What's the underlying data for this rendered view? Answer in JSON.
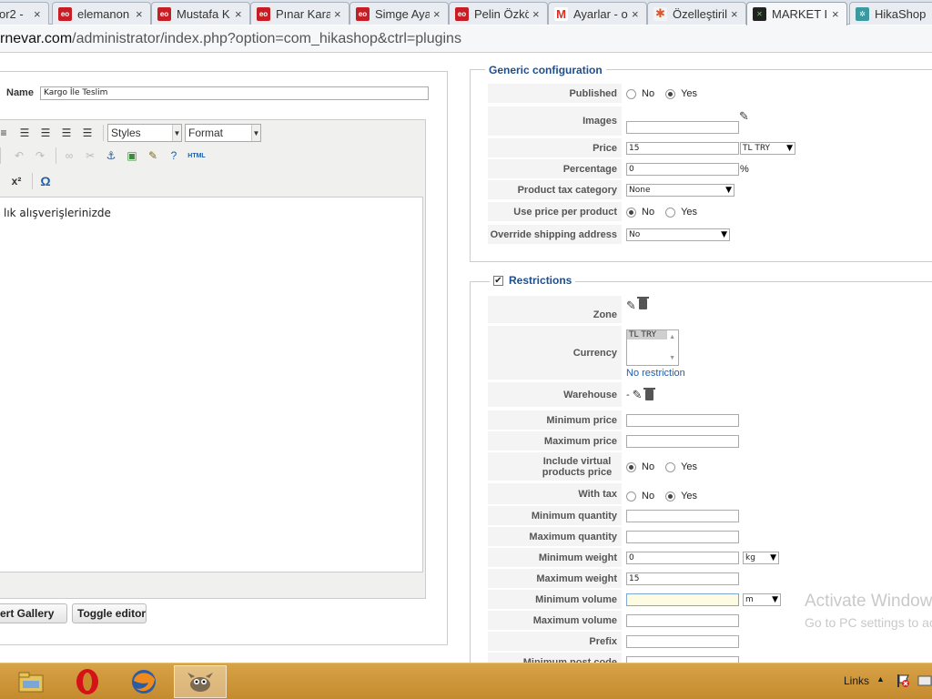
{
  "browser": {
    "tabs": [
      {
        "label": "or2 -",
        "icon": "generic-page-icon",
        "active": false
      },
      {
        "label": "elemanon",
        "icon": "eo-icon",
        "active": false
      },
      {
        "label": "Mustafa K",
        "icon": "eo-icon",
        "active": false
      },
      {
        "label": "Pınar Kara",
        "icon": "eo-icon",
        "active": false
      },
      {
        "label": "Simge Aya",
        "icon": "eo-icon",
        "active": false
      },
      {
        "label": "Pelin Özkö",
        "icon": "eo-icon",
        "active": false
      },
      {
        "label": "Ayarlar - o",
        "icon": "gmail-icon",
        "active": false
      },
      {
        "label": "Özelleştiril",
        "icon": "joomla-icon",
        "active": false
      },
      {
        "label": "MARKET II",
        "icon": "market-icon",
        "active": true
      },
      {
        "label": "HikaShop",
        "icon": "hikashop-icon",
        "active": false
      }
    ],
    "tab_close_glyph": "×",
    "url_host": "rnevar.com",
    "url_path": "/administrator/index.php?option=com_hikashop&ctrl=plugins"
  },
  "editor": {
    "name_label": "Name",
    "name_value": "Kargo İle Teslim",
    "styles_select": "Styles",
    "format_select": "Format",
    "superscript": "x²",
    "omega": "Ω",
    "html_label": "HTML",
    "body_text": "lık alışverişlerinizde",
    "insert_gallery_button": "ert Gallery",
    "toggle_editor_button": "Toggle editor"
  },
  "generic_config": {
    "legend": "Generic configuration",
    "published": {
      "label": "Published",
      "options": [
        "No",
        "Yes"
      ],
      "selected": "Yes"
    },
    "images": {
      "label": "Images",
      "value": ""
    },
    "price": {
      "label": "Price",
      "value": "15",
      "currency": "TL TRY"
    },
    "percentage": {
      "label": "Percentage",
      "value": "0",
      "unit": "%"
    },
    "product_tax_category": {
      "label": "Product tax category",
      "value": "None"
    },
    "use_price_per_product": {
      "label": "Use price per product",
      "options": [
        "No",
        "Yes"
      ],
      "selected": "No"
    },
    "override_shipping_address": {
      "label": "Override shipping address",
      "value": "No"
    }
  },
  "restrictions": {
    "legend": "Restrictions",
    "enabled": true,
    "zone": {
      "label": "Zone"
    },
    "currency": {
      "label": "Currency",
      "list_item": "TL TRY",
      "note": "No restriction"
    },
    "warehouse": {
      "label": "Warehouse",
      "value": "-"
    },
    "minimum_price": {
      "label": "Minimum price",
      "value": ""
    },
    "maximum_price": {
      "label": "Maximum price",
      "value": ""
    },
    "include_virtual": {
      "label": "Include virtual products price",
      "options": [
        "No",
        "Yes"
      ],
      "selected": "No"
    },
    "with_tax": {
      "label": "With tax",
      "options": [
        "No",
        "Yes"
      ],
      "selected": "Yes"
    },
    "minimum_quantity": {
      "label": "Minimum quantity",
      "value": ""
    },
    "maximum_quantity": {
      "label": "Maximum quantity",
      "value": ""
    },
    "minimum_weight": {
      "label": "Minimum weight",
      "value": "0",
      "unit": "kg"
    },
    "maximum_weight": {
      "label": "Maximum weight",
      "value": "15"
    },
    "minimum_volume": {
      "label": "Minimum volume",
      "value": "",
      "unit": "m"
    },
    "maximum_volume": {
      "label": "Maximum volume",
      "value": ""
    },
    "prefix": {
      "label": "Prefix",
      "value": ""
    },
    "minimum_post_code": {
      "label": "Minimum post code",
      "value": ""
    }
  },
  "watermark": {
    "line1": "Activate Windows",
    "line2": "Go to PC settings to activate"
  },
  "taskbar": {
    "apps": [
      "file-explorer-icon",
      "opera-icon",
      "firefox-icon",
      "gimp-icon"
    ],
    "active_app": "gimp-icon",
    "tray_links": "Links",
    "tray_arrow": "▲"
  },
  "colors": {
    "legend_blue": "#1f4e8c",
    "taskbar": "#c9902f",
    "row_label_bg": "#f4f4f4"
  }
}
